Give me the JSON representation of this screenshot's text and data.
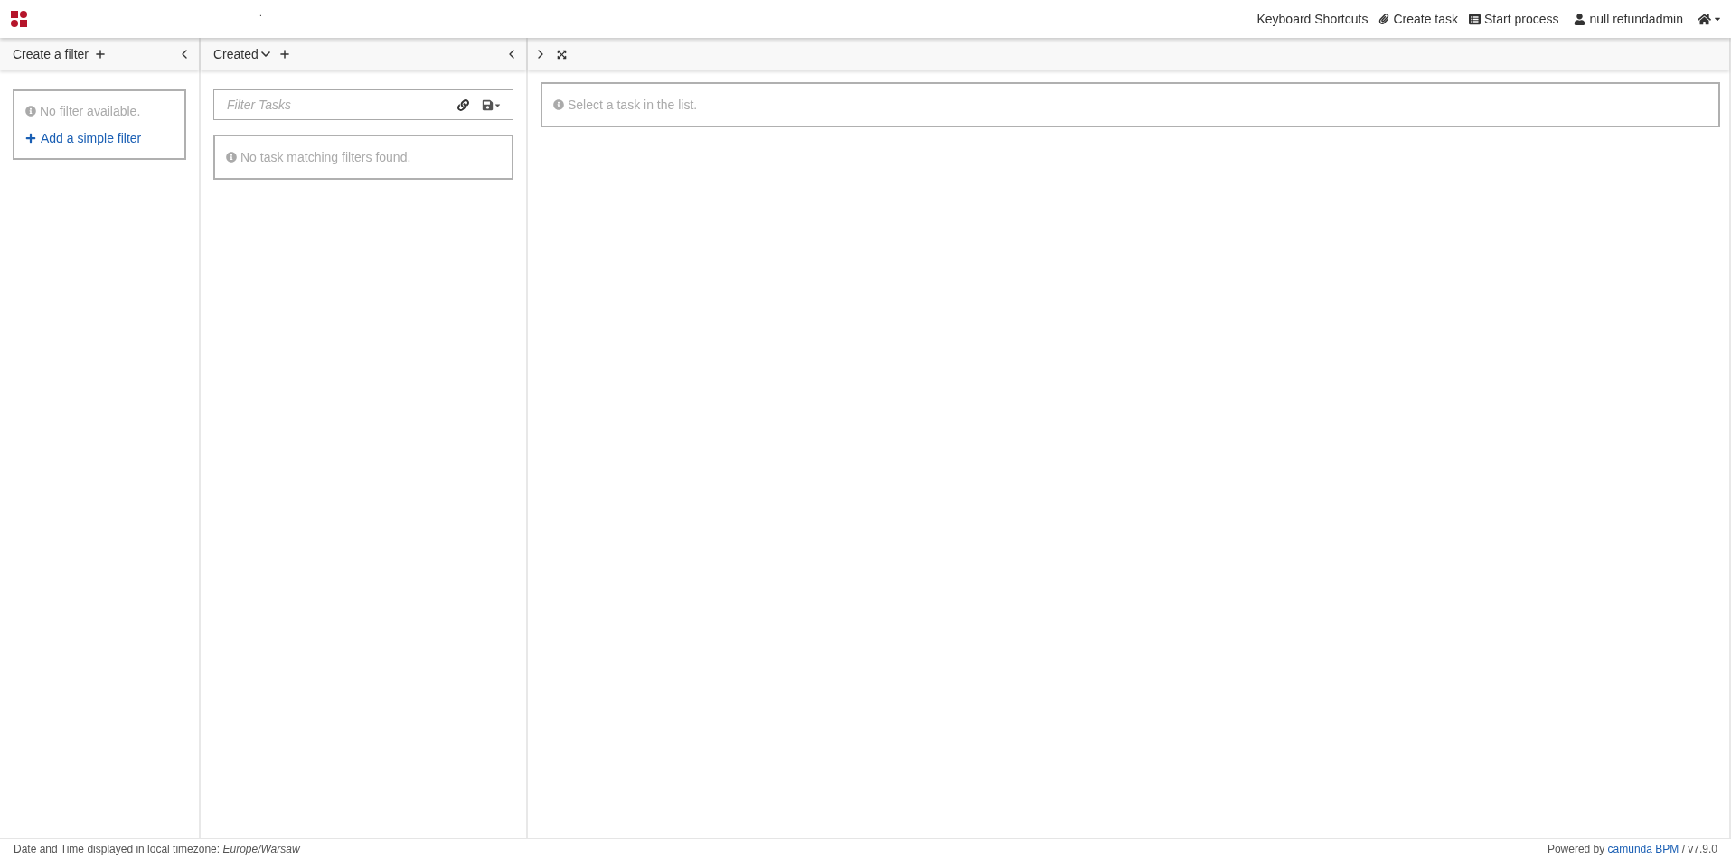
{
  "header": {
    "brand": ".",
    "nav": [
      {
        "kind": "plain",
        "label": "Keyboard Shortcuts"
      },
      {
        "kind": "task",
        "label": "Create task"
      },
      {
        "kind": "process",
        "label": "Start process"
      },
      {
        "kind": "user",
        "label": "null refundadmin"
      }
    ]
  },
  "filters_panel": {
    "title": "Create a filter",
    "message": "No filter available.",
    "add_link": "Add a simple filter"
  },
  "list_panel": {
    "sort": "Created",
    "search": {
      "placeholder": "Filter Tasks"
    },
    "message": "No task matching filters found."
  },
  "task_panel": {
    "message": "Select a task in the list."
  },
  "footer": {
    "timezone": "Date and Time displayed in local timezone: *Europe/Warsaw*",
    "powered_prefix": "Powered by",
    "powered_link": "camunda BPM",
    "powered_suffix": "/ v7.9.0"
  }
}
